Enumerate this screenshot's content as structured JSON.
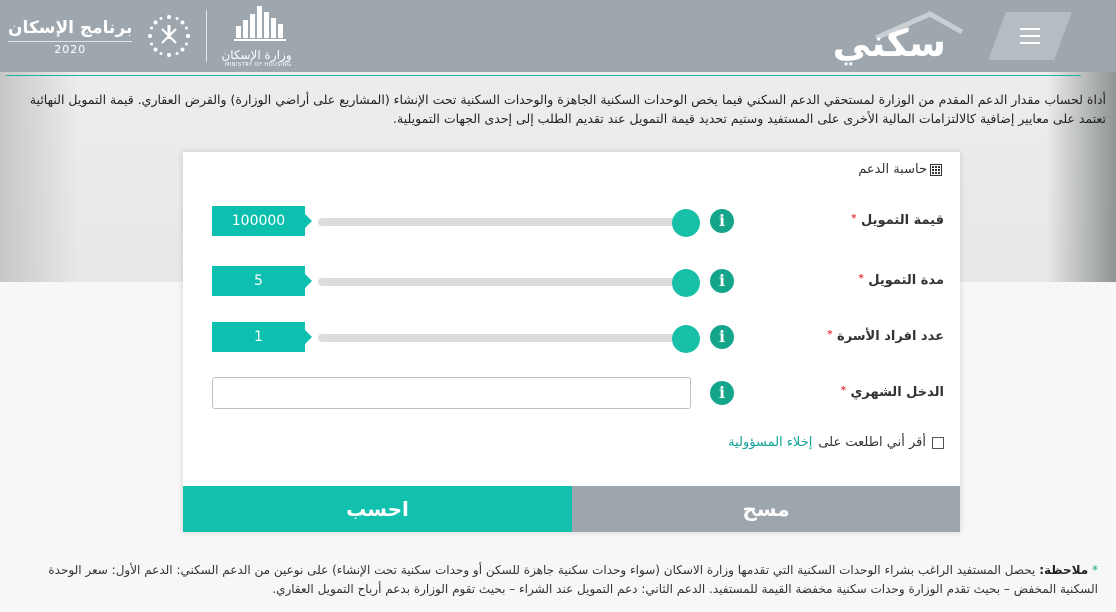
{
  "header": {
    "brand": "سكني",
    "program_title": "برنامج الإسكان",
    "program_year": "2020",
    "ministry_name": "وزارة الإسكان",
    "ministry_en": "MINISTRY OF HOUSING"
  },
  "intro": {
    "text": "أداة لحساب مقدار الدعم المقدم من الوزارة لمستحقي الدعم السكني فيما يخص الوحدات السكنية الجاهزة والوحدات السكنية تحت الإنشاء (المشاريع على أراضي الوزارة) والقرض العقاري. قيمة التمويل النهائية تعتمد على معايير إضافية كالالتزامات المالية الأخرى على المستفيد وستيم تحديد قيمة التمويل عند تقديم الطلب إلى إحدى الجهات التمويلية."
  },
  "calculator": {
    "title": "حاسبة الدعم",
    "fields": [
      {
        "label": "قيمة التمويل",
        "value": "100000",
        "slider_level": 1.0
      },
      {
        "label": "مدة التمويل",
        "value": "5",
        "slider_level": 1.0
      },
      {
        "label": "عدد افراد الأسرة",
        "value": "1",
        "slider_level": 1.0
      },
      {
        "label": "الدخل الشهري",
        "value": "",
        "placeholder": ""
      }
    ],
    "required_mark": "*",
    "info_glyph": "i",
    "consent_prefix": "أقر أني اطلعت على",
    "consent_link": "إخلاء المسؤولية",
    "clear_label": "مسح",
    "calculate_label": "احسب"
  },
  "note": {
    "label": "ملاحظة:",
    "star": "*",
    "text": "يحصل المستفيد الراغب بشراء الوحدات السكنية التي تقدمها وزارة الاسكان (سواء وحدات سكنية جاهزة للسكن أو وحدات سكنية تحت الإنشاء) على نوعين من الدعم السكني: الدعم الأول: سعر الوحدة السكنية المخفض – بحيث تقدم الوزارة وحدات سكنية مخفضة القيمة للمستفيد. الدعم الثاني: دعم التمويل عند الشراء – بحيث تقوم الوزارة بدعم أرباح التمويل العقاري."
  },
  "colors": {
    "header_bg": "#9ea7ae",
    "accent_teal": "#11c1ad",
    "slider_thumb": "#19c0a8",
    "info_green": "#14a58a",
    "clear_button": "#9ea6ad",
    "required_red": "#e63946"
  }
}
